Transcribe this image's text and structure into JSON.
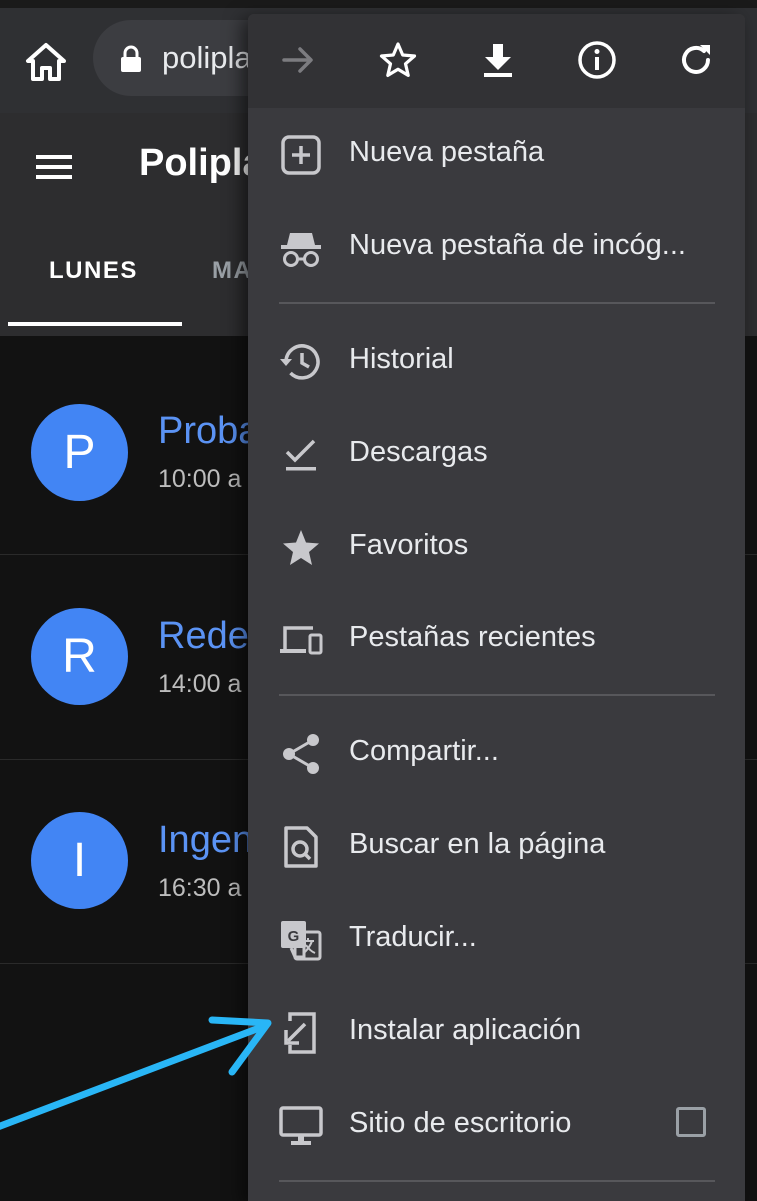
{
  "browser": {
    "url_display": "polipla",
    "icons": [
      "home-icon",
      "lock-icon"
    ]
  },
  "app": {
    "title": "Polipla",
    "tabs": [
      {
        "label": "LUNES",
        "selected": true
      },
      {
        "label": "MA",
        "selected": false
      }
    ],
    "items": [
      {
        "initial": "P",
        "title": "Proba",
        "time": "10:00 a"
      },
      {
        "initial": "R",
        "title": "Redes",
        "time": "14:00 a"
      },
      {
        "initial": "I",
        "title": "Ingen",
        "time": "16:30 a"
      }
    ]
  },
  "menu": {
    "toolbar": [
      "forward-icon",
      "star-icon",
      "download-icon",
      "info-icon",
      "refresh-icon"
    ],
    "items": [
      {
        "label": "Nueva pestaña",
        "icon": "new-tab-icon"
      },
      {
        "label": "Nueva pestaña de incóg...",
        "icon": "incognito-icon"
      },
      {
        "label": "Historial",
        "icon": "history-icon"
      },
      {
        "label": "Descargas",
        "icon": "downloads-icon"
      },
      {
        "label": "Favoritos",
        "icon": "bookmarks-star-icon"
      },
      {
        "label": "Pestañas recientes",
        "icon": "devices-icon"
      },
      {
        "label": "Compartir...",
        "icon": "share-icon"
      },
      {
        "label": "Buscar en la página",
        "icon": "find-in-page-icon"
      },
      {
        "label": "Traducir...",
        "icon": "translate-icon"
      },
      {
        "label": "Instalar aplicación",
        "icon": "install-app-icon"
      },
      {
        "label": "Sitio de escritorio",
        "icon": "desktop-icon",
        "checked": false
      }
    ]
  },
  "colors": {
    "accent": "#4285f4",
    "annotation_arrow": "#29b6f6"
  }
}
